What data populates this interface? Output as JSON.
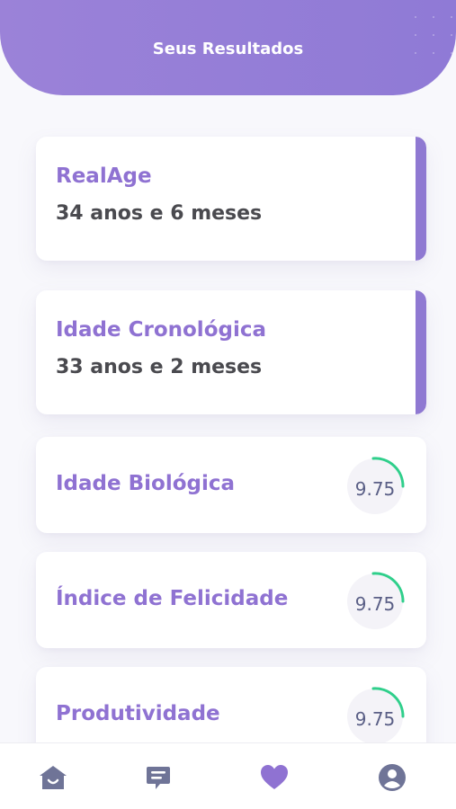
{
  "header": {
    "title": "Seus Resultados"
  },
  "cards": [
    {
      "title": "RealAge",
      "value": "34 anos e 6 meses"
    },
    {
      "title": "Idade Cronológica",
      "value": "33 anos e 2 meses"
    }
  ],
  "scores": [
    {
      "title": "Idade Biológica",
      "value": "9.75"
    },
    {
      "title": "Índice de Felicidade",
      "value": "9.75"
    },
    {
      "title": "Produtividade",
      "value": "9.75"
    }
  ],
  "nav": {
    "home_icon": "home-icon",
    "chat_icon": "chat-icon",
    "favorites_icon": "heart-icon",
    "profile_icon": "user-icon",
    "active_color": "#8f72d2",
    "inactive_color": "#6f7497"
  }
}
